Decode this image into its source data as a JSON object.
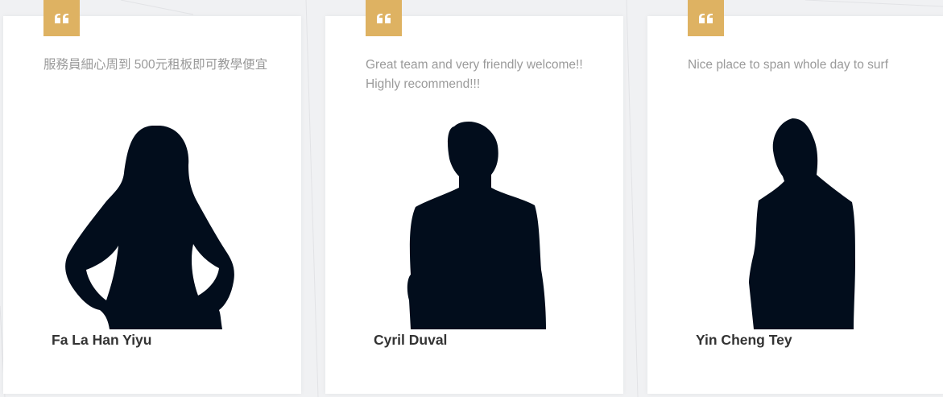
{
  "theme": {
    "accent": "#deb262",
    "silhouette": "#020d1c",
    "quote_text_color": "#9a9a9a",
    "name_color": "#333333"
  },
  "testimonials": [
    {
      "quote_icon": "quote-icon",
      "text": "服務員細心周到 500元租板即可教學便宜",
      "author": "Fa La Han Yiyu",
      "avatar": "female-silhouette-avatar"
    },
    {
      "quote_icon": "quote-icon",
      "text": "Great team and very friendly welcome!! Highly recommend!!!",
      "author": "Cyril Duval",
      "avatar": "male-silhouette-avatar"
    },
    {
      "quote_icon": "quote-icon",
      "text": "Nice place to span whole day to surf",
      "author": "Yin Cheng Tey",
      "avatar": "male-side-silhouette-avatar"
    }
  ]
}
